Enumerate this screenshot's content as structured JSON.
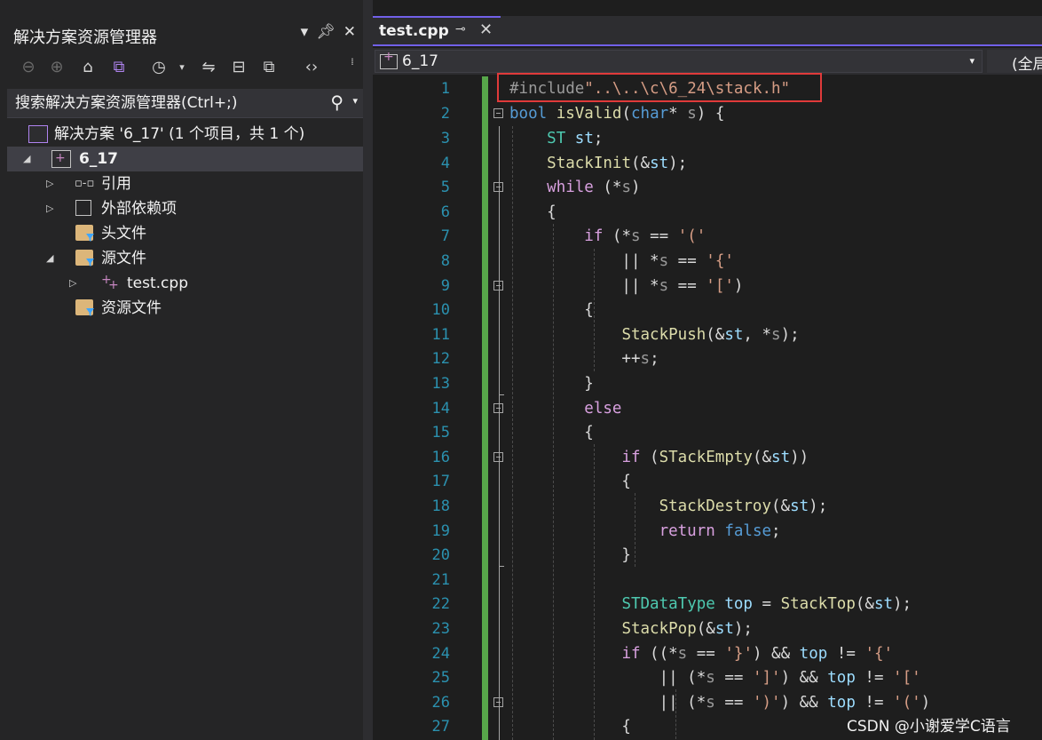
{
  "solution_explorer": {
    "title": "解决方案资源管理器",
    "pin_icon": "pin-icon",
    "close_icon": "close-icon",
    "search_placeholder": "搜索解决方案资源管理器(Ctrl+;)",
    "solution_label": "解决方案 '6_17' (1 个项目，共 1 个)",
    "project_label": "6_17",
    "items": [
      {
        "label": "引用"
      },
      {
        "label": "外部依赖项"
      },
      {
        "label": "头文件"
      },
      {
        "label": "源文件"
      },
      {
        "label": "test.cpp"
      },
      {
        "label": "资源文件"
      }
    ]
  },
  "editor": {
    "tab_label": "test.cpp",
    "nav_project": "6_17",
    "nav_scope": "(全局",
    "line_numbers": [
      "1",
      "2",
      "3",
      "4",
      "5",
      "6",
      "7",
      "8",
      "9",
      "10",
      "11",
      "12",
      "13",
      "14",
      "15",
      "16",
      "17",
      "18",
      "19",
      "20",
      "21",
      "22",
      "23",
      "24",
      "25",
      "26",
      "27"
    ],
    "code_lines": [
      "#include\"..\\..\\c\\6_24\\stack.h\"",
      "bool isValid(char* s) {",
      "    ST st;",
      "    StackInit(&st);",
      "    while (*s)",
      "    {",
      "        if (*s == '('",
      "            || *s == '{'",
      "            || *s == '[')",
      "        {",
      "            StackPush(&st, *s);",
      "            ++s;",
      "        }",
      "        else",
      "        {",
      "            if (STackEmpty(&st))",
      "            {",
      "                StackDestroy(&st);",
      "                return false;",
      "            }",
      "",
      "            STDataType top = StackTop(&st);",
      "            StackPop(&st);",
      "            if ((*s == '}') && top != '{'",
      "                || (*s == ']') && top != '['",
      "                || (*s == ')') && top != '(')",
      "            {"
    ]
  },
  "watermark": "CSDN @小谢爱学C语言",
  "colors": {
    "accent": "#7160e8",
    "highlight_box": "#e03a3a",
    "change_bar": "#57a64a"
  }
}
